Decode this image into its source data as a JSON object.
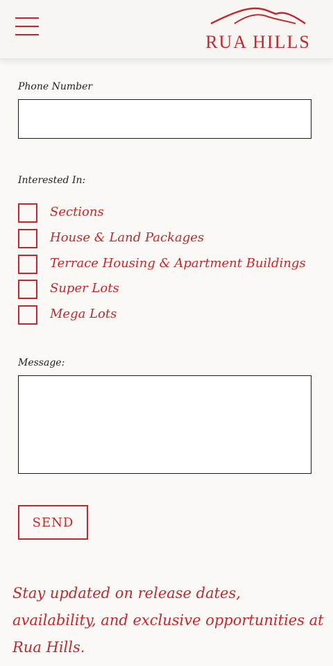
{
  "header": {
    "brand": "RUA HILLS",
    "menu_icon": "hamburger-menu-icon",
    "logo_icon": "hills-logo-icon",
    "accent_color": "#c0282d"
  },
  "form": {
    "phone_label": "Phone Number",
    "phone_value": "",
    "interested_label": "Interested In:",
    "options": [
      {
        "label": "Sections",
        "checked": false
      },
      {
        "label": "House & Land Packages",
        "checked": false
      },
      {
        "label": "Terrace Housing & Apartment Buildings",
        "checked": false
      },
      {
        "label": "Super Lots",
        "checked": false
      },
      {
        "label": "Mega Lots",
        "checked": false
      }
    ],
    "message_label": "Message:",
    "message_value": "",
    "send_label": "SEND"
  },
  "footer": {
    "text": "Stay updated on release dates, availability, and exclusive opportunities at Rua Hills."
  }
}
